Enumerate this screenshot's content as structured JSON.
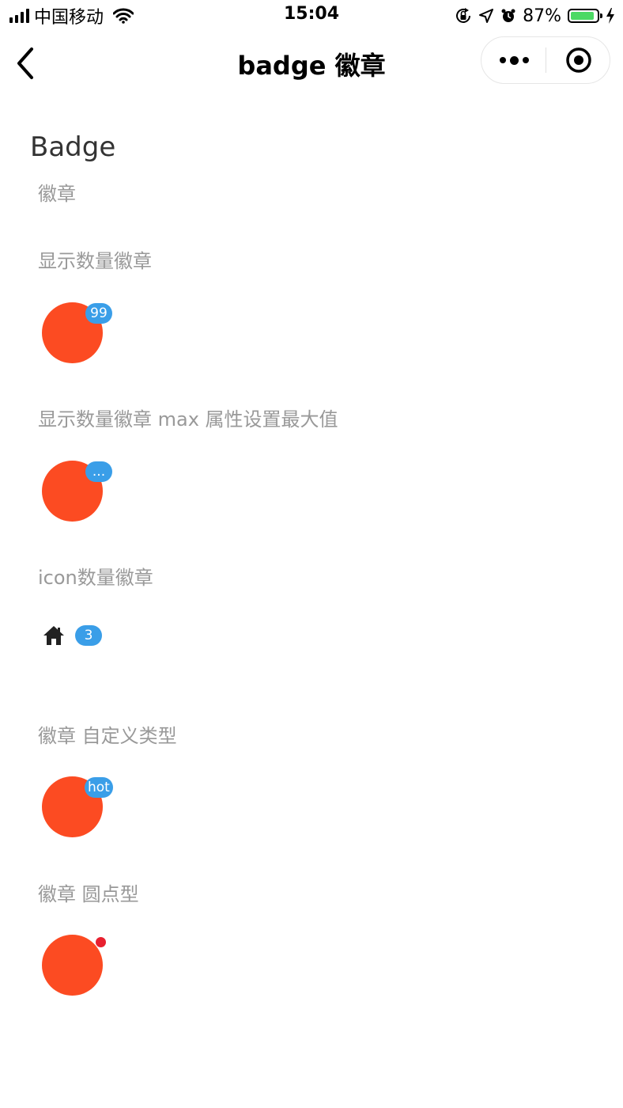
{
  "status_bar": {
    "carrier": "中国移动",
    "time": "15:04",
    "battery_percent": "87%",
    "battery_level": 0.87,
    "icons": [
      "signal-icon",
      "wifi-icon",
      "orientation-lock-icon",
      "location-icon",
      "alarm-icon",
      "battery-icon",
      "charging-icon"
    ]
  },
  "nav": {
    "title": "badge 徽章",
    "icons": [
      "back-chevron-icon",
      "more-dots-icon",
      "target-icon"
    ]
  },
  "page": {
    "title": "Badge",
    "subtitle": "徽章"
  },
  "sections": [
    {
      "title": "显示数量徽章",
      "badge": "99"
    },
    {
      "title": "显示数量徽章 max 属性设置最大值",
      "badge": "..."
    },
    {
      "title": "icon数量徽章",
      "badge": "3",
      "icon": "home-icon"
    },
    {
      "title": "徽章 自定义类型",
      "badge": "hot"
    },
    {
      "title": "徽章 圆点型"
    }
  ],
  "colors": {
    "avatar": "#fc4b22",
    "badge": "#3a9ee8",
    "dot": "#e8202f",
    "battery": "#4cd964"
  }
}
